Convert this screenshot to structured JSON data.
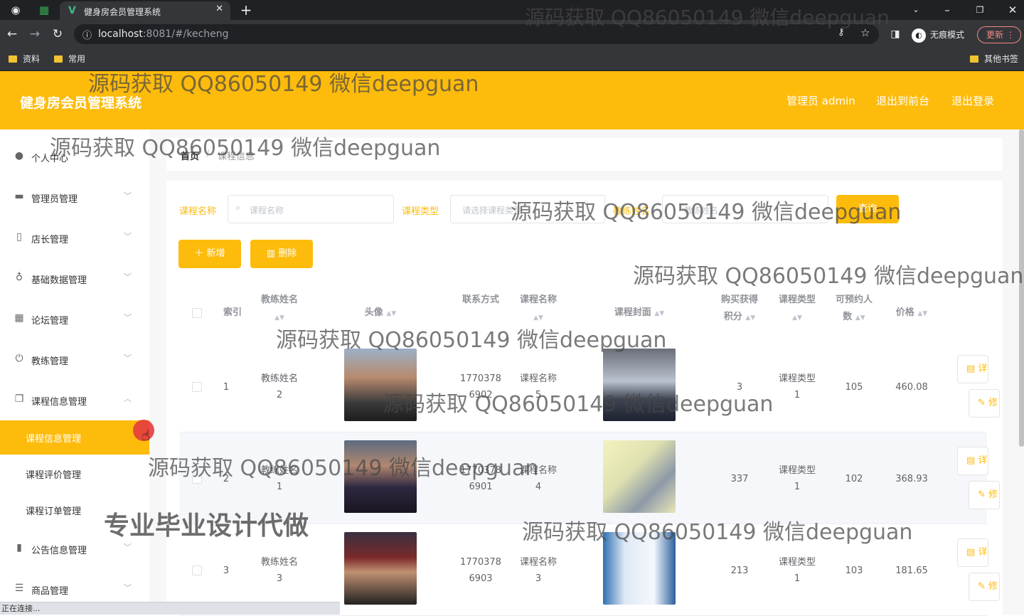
{
  "browser": {
    "tab_title": "健身房会员管理系统",
    "url_host": "localhost",
    "url_rest": ":8081/#/kecheng",
    "incognito_label": "无痕模式",
    "update_label": "更新",
    "bookmarks": [
      "资料",
      "常用"
    ],
    "other_bookmarks": "其他书签",
    "status": "正在连接..."
  },
  "header": {
    "title": "健身房会员管理系统",
    "admin": "管理员 admin",
    "to_front": "退出到前台",
    "logout": "退出登录"
  },
  "sidebar": {
    "items": [
      {
        "label": "个人中心",
        "icon": "user-icon"
      },
      {
        "label": "管理员管理",
        "icon": "briefcase-icon"
      },
      {
        "label": "店长管理",
        "icon": "phone-icon"
      },
      {
        "label": "基础数据管理",
        "icon": "mic-icon"
      },
      {
        "label": "论坛管理",
        "icon": "grid-icon"
      },
      {
        "label": "教练管理",
        "icon": "power-icon"
      },
      {
        "label": "课程信息管理",
        "icon": "copy-icon"
      }
    ],
    "sub_items": [
      "课程信息管理",
      "课程评价管理",
      "课程订单管理"
    ],
    "items_after": [
      {
        "label": "公告信息管理",
        "icon": "chart-icon"
      },
      {
        "label": "商品管理",
        "icon": "list-icon"
      }
    ]
  },
  "breadcrumb": {
    "home": "首页",
    "sep": "/",
    "current": "课程信息"
  },
  "filters": {
    "name_label": "课程名称",
    "name_placeholder": "课程名称",
    "type_label": "课程类型",
    "type_placeholder": "请选择课程类型",
    "third_label": "教练姓名",
    "third_placeholder": "教练姓名",
    "search_btn": "查询"
  },
  "actions": {
    "add": "＋ 新增",
    "delete": "删除"
  },
  "table": {
    "headers": {
      "index": "索引",
      "coach_name": "教练姓名",
      "avatar": "头像",
      "contact": "联系方式",
      "course_name": "课程名称",
      "cover": "课程封面",
      "points_1": "购买获得",
      "points_2": "积分",
      "course_type": "课程类型",
      "bookable_1": "可预约人",
      "bookable_2": "数",
      "price": "价格"
    },
    "rows": [
      {
        "index": "1",
        "coach_1": "教练姓名",
        "coach_2": "2",
        "contact_1": "1770378",
        "contact_2": "6902",
        "course_1": "课程名称",
        "course_2": "5",
        "points": "3",
        "type_1": "课程类型",
        "type_2": "1",
        "bookable": "105",
        "price": "460.08"
      },
      {
        "index": "2",
        "coach_1": "教练姓名",
        "coach_2": "1",
        "contact_1": "1770378",
        "contact_2": "6901",
        "course_1": "课程名称",
        "course_2": "4",
        "points": "337",
        "type_1": "课程类型",
        "type_2": "1",
        "bookable": "102",
        "price": "368.93"
      },
      {
        "index": "3",
        "coach_1": "教练姓名",
        "coach_2": "3",
        "contact_1": "1770378",
        "contact_2": "6903",
        "course_1": "课程名称",
        "course_2": "3",
        "points": "213",
        "type_1": "课程类型",
        "type_2": "1",
        "bookable": "103",
        "price": "181.65"
      }
    ],
    "op_labels": [
      "详情",
      "修改"
    ]
  },
  "watermarks": {
    "qq": "源码获取 QQ86050149 微信deepguan",
    "thesis": "专业毕业设计代做"
  },
  "colors": {
    "accent": "#fdbb0c",
    "chrome_dark": "#202124",
    "chrome_mid": "#35363a"
  }
}
